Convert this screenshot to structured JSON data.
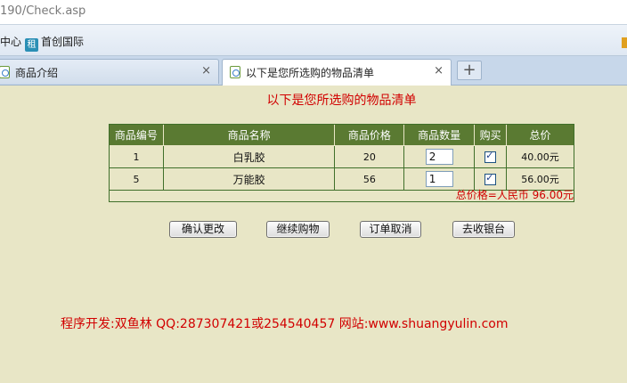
{
  "browser": {
    "address": "190/Check.asp",
    "favorites": [
      {
        "label": "中心"
      },
      {
        "badge": "租",
        "label": "首创国际"
      }
    ],
    "tabs": [
      {
        "label": "商品介绍",
        "close": "×"
      },
      {
        "label": "以下是您所选购的物品清单",
        "close": "×"
      }
    ],
    "new_tab": "+"
  },
  "page": {
    "title": "以下是您所选购的物品清单",
    "table": {
      "headers": [
        "商品编号",
        "商品名称",
        "商品价格",
        "商品数量",
        "购买",
        "总价"
      ],
      "rows": [
        {
          "id": "1",
          "name": "白乳胶",
          "price": "20",
          "qty": "2",
          "buy": true,
          "total": "40.00元"
        },
        {
          "id": "5",
          "name": "万能胶",
          "price": "56",
          "qty": "1",
          "buy": true,
          "total": "56.00元"
        }
      ],
      "grand_total": "总价格=人民币 96.00元"
    },
    "buttons": [
      "确认更改",
      "继续购物",
      "订单取消",
      "去收银台"
    ],
    "footer": "程序开发:双鱼林 QQ:287307421或254540457 网站:www.shuangyulin.com"
  }
}
